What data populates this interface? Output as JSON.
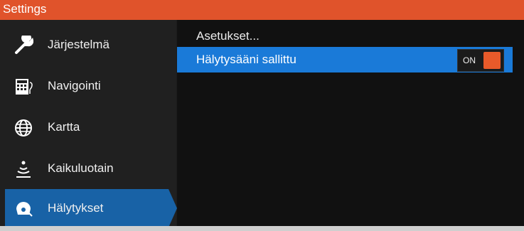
{
  "window": {
    "title": "Settings"
  },
  "sidebar": {
    "items": [
      {
        "label": "Järjestelmä",
        "icon": "wrench-icon"
      },
      {
        "label": "Navigointi",
        "icon": "calculator-icon"
      },
      {
        "label": "Kartta",
        "icon": "globe-icon"
      },
      {
        "label": "Kaikuluotain",
        "icon": "sonar-icon"
      },
      {
        "label": "Hälytykset",
        "icon": "alarm-icon"
      }
    ],
    "active_index": 4
  },
  "main": {
    "heading": "Asetukset...",
    "alarm_row": {
      "label": "Hälytysääni sallittu",
      "toggle_text": "ON"
    }
  },
  "colors": {
    "accent": "#e0532b",
    "selection": "#1a7ad8",
    "active_nav": "#1862a6",
    "toggle_knob": "#e85a2a"
  }
}
